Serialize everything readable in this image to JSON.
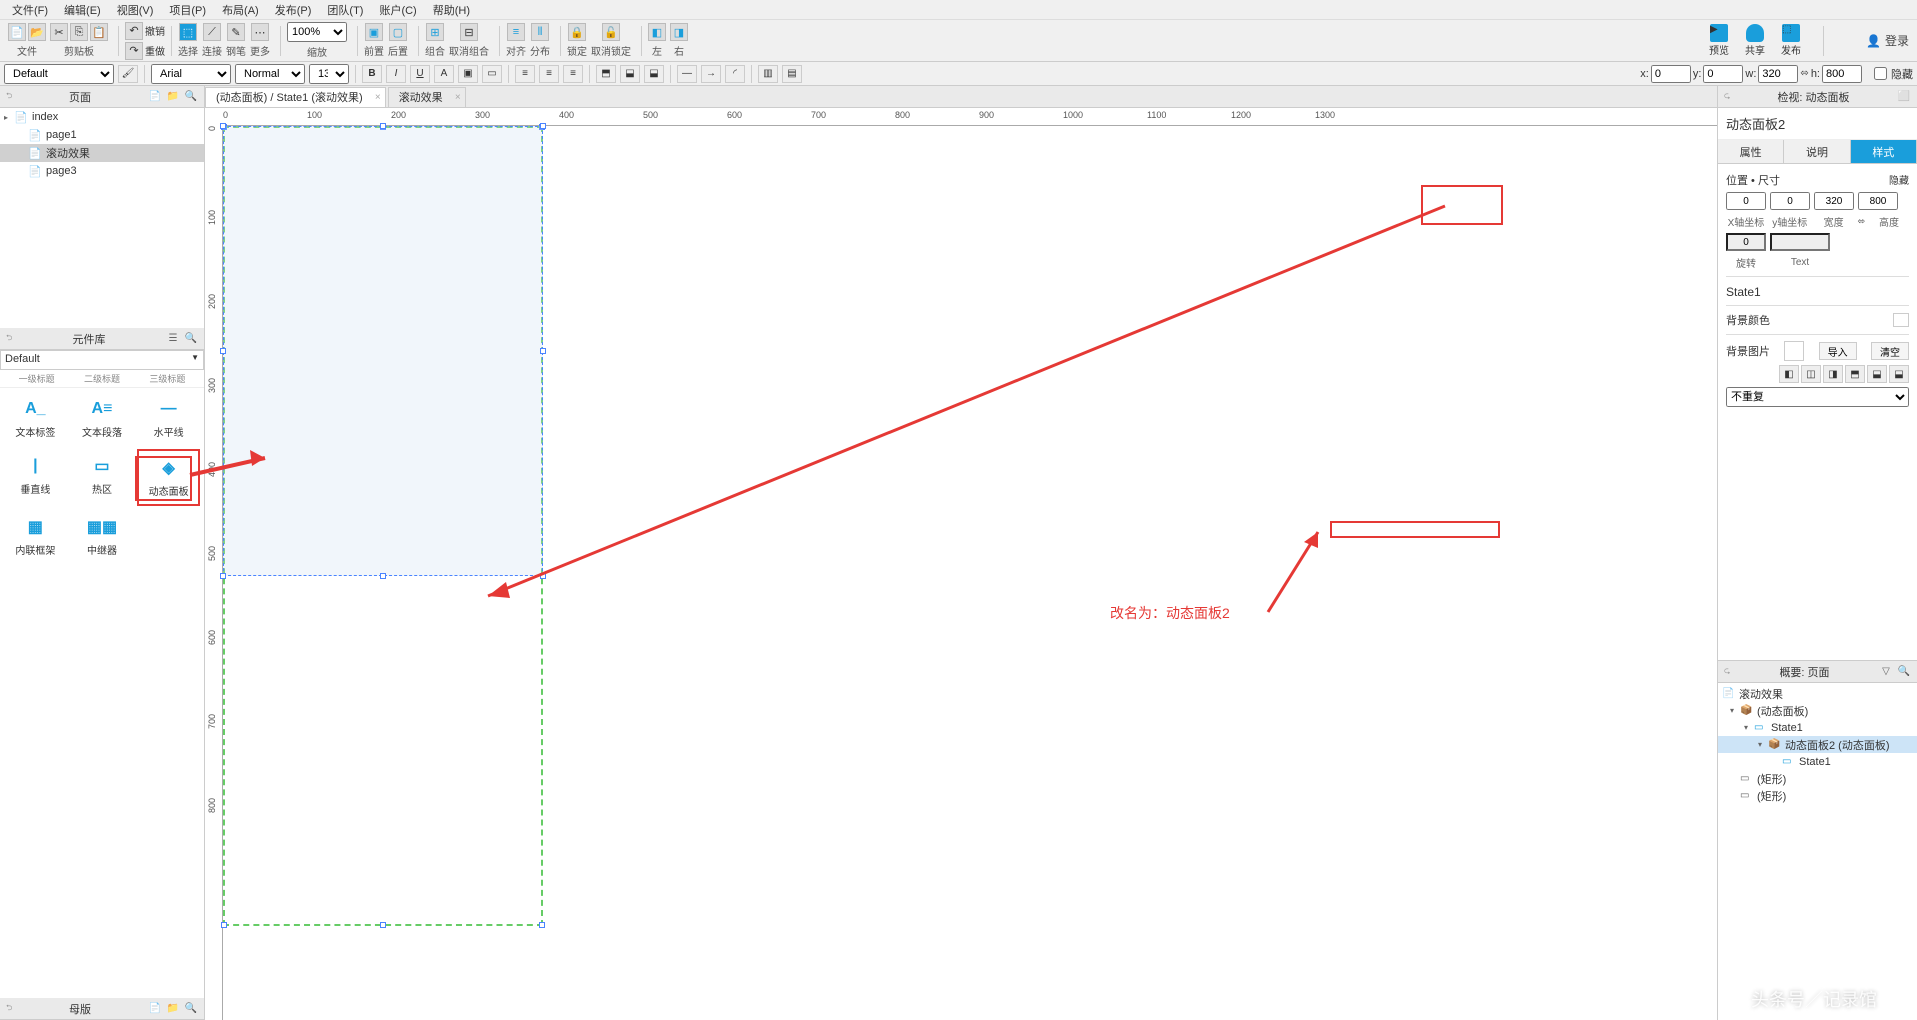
{
  "menu": {
    "items": [
      "文件(F)",
      "编辑(E)",
      "视图(V)",
      "项目(P)",
      "布局(A)",
      "发布(P)",
      "团队(T)",
      "账户(C)",
      "帮助(H)"
    ]
  },
  "toolbar": {
    "groups": [
      {
        "label": "文件",
        "icons": 2
      },
      {
        "label": "剪贴板",
        "icons": 3
      }
    ],
    "labeledButtons": [
      {
        "label": "撤销"
      },
      {
        "label": "重做"
      }
    ],
    "singleGroups": [
      "选择",
      "连接",
      "钢笔",
      "更多"
    ],
    "zoom": "100%",
    "zoomLabel": "缩放",
    "alignGroups": [
      "前置",
      "后置"
    ],
    "containerGroups": [
      "组合",
      "取消组合"
    ],
    "alignLabel": "对齐",
    "distributeLabel": "分布",
    "lockGroups": [
      "锁定",
      "取消锁定"
    ],
    "leftRight": [
      "左",
      "右"
    ],
    "rightButtons": [
      {
        "label": "预览"
      },
      {
        "label": "共享"
      },
      {
        "label": "发布"
      }
    ],
    "login": "登录"
  },
  "subtoolbar": {
    "default": "Default",
    "font": "Arial",
    "weight": "Normal",
    "size": "13",
    "x": "0",
    "y": "0",
    "w": "320",
    "h": "800",
    "xLabel": "x:",
    "yLabel": "y:",
    "wLabel": "w:",
    "hLabel": "h:",
    "hideLabel": "隐藏"
  },
  "leftPanels": {
    "pages": {
      "title": "页面",
      "items": [
        {
          "name": "index",
          "level": 0,
          "arrow": "▸",
          "icon": "📄"
        },
        {
          "name": "page1",
          "level": 1,
          "icon": "📄"
        },
        {
          "name": "滚动效果",
          "level": 1,
          "selected": true,
          "icon": "📄"
        },
        {
          "name": "page3",
          "level": 1,
          "icon": "📄"
        }
      ]
    },
    "widgets": {
      "title": "元件库",
      "default": "Default",
      "topRow": [
        "一级标题",
        "二级标题",
        "三级标题"
      ],
      "items": [
        {
          "name": "文本标签",
          "icon": "A_"
        },
        {
          "name": "文本段落",
          "icon": "A≡"
        },
        {
          "name": "水平线",
          "icon": "—"
        },
        {
          "name": "垂直线",
          "icon": "|"
        },
        {
          "name": "热区",
          "icon": "▭"
        },
        {
          "name": "动态面板",
          "icon": "◈",
          "highlighted": true
        },
        {
          "name": "内联框架",
          "icon": "▦"
        },
        {
          "name": "中继器",
          "icon": "▦▦"
        }
      ]
    },
    "master": {
      "title": "母版"
    }
  },
  "tabs": {
    "items": [
      {
        "label": "(动态面板) / State1 (滚动效果)",
        "active": true
      },
      {
        "label": "滚动效果",
        "active": false
      }
    ]
  },
  "ruler": {
    "hTicks": [
      0,
      100,
      200,
      300,
      400,
      500,
      600,
      700,
      800,
      900,
      1000,
      1100,
      1200,
      1300
    ],
    "vTicks": [
      0,
      100,
      200,
      300,
      400,
      500,
      600,
      700,
      800
    ]
  },
  "inspector": {
    "header": "检视: 动态面板",
    "object": "动态面板2",
    "tabs": [
      "属性",
      "说明",
      "样式"
    ],
    "activeTab": 2,
    "posSize": {
      "title": "位置 • 尺寸",
      "hideLabel": "隐藏",
      "x": "0",
      "y": "0",
      "w": "320",
      "h": "800",
      "xLabel": "X轴坐标",
      "yLabel": "y轴坐标",
      "wLabel": "宽度",
      "hLabel": "高度",
      "rot": "0",
      "rotLabel": "旋转",
      "text": "",
      "textLabel": "Text"
    },
    "stateTitle": "State1",
    "bgColor": "背景颜色",
    "bgImage": {
      "label": "背景图片",
      "import": "导入",
      "clear": "清空"
    },
    "repeat": "不重复"
  },
  "outline": {
    "title": "概要: 页面",
    "root": "滚动效果",
    "items": [
      {
        "name": "(动态面板)",
        "level": 0,
        "arrow": "▾",
        "icon": "📦"
      },
      {
        "name": "State1",
        "level": 1,
        "arrow": "▾",
        "icon": "▭",
        "color": "#1a9edb"
      },
      {
        "name": "动态面板2 (动态面板)",
        "level": 2,
        "arrow": "▾",
        "icon": "📦",
        "selected": true
      },
      {
        "name": "State1",
        "level": 3,
        "icon": "▭",
        "color": "#1a9edb"
      },
      {
        "name": "(矩形)",
        "level": 0,
        "icon": "▭"
      },
      {
        "name": "(矩形)",
        "level": 0,
        "icon": "▭"
      }
    ]
  },
  "annotations": {
    "rename": "改名为：动态面板2"
  },
  "watermark": "头条号／记录馆"
}
